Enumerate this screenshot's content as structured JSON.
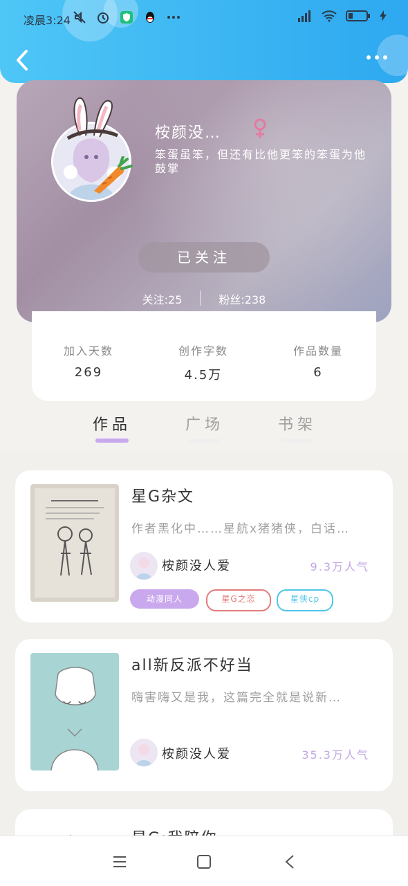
{
  "status_bar": {
    "time": "凌晨3:24",
    "icons": [
      "mute-icon",
      "alarm-icon",
      "security-app-icon",
      "qq-icon",
      "more-dots-icon"
    ],
    "right_icons": [
      "signal-icon",
      "wifi-icon",
      "battery-icon",
      "charging-icon"
    ]
  },
  "header": {
    "back_icon": "chevron-left-icon",
    "more_icon": "more-horizontal-icon"
  },
  "profile": {
    "username": "桉颜没…",
    "gender_icon": "female-icon",
    "bio": "笨蛋虽笨，但还有比他更笨的笨蛋为他鼓掌",
    "follow_button": "已关注",
    "following_text": "关注:25",
    "followers_text": "粉丝:238"
  },
  "stats": [
    {
      "label": "加入天数",
      "value": "269"
    },
    {
      "label": "创作字数",
      "value": "4.5万"
    },
    {
      "label": "作品数量",
      "value": "6"
    }
  ],
  "tabs": [
    {
      "label": "作品",
      "active": true
    },
    {
      "label": "广场",
      "active": false
    },
    {
      "label": "书架",
      "active": false
    }
  ],
  "works": [
    {
      "title": "星G杂文",
      "description": "作者黑化中……星航x猪猪侠，白话…",
      "author": "桉颜没人爱",
      "popularity": "9.3万人气",
      "tags": [
        "动漫同人",
        "星G之恋",
        "星侠cp"
      ]
    },
    {
      "title": "all新反派不好当",
      "description": "嗨害嗨又是我，这篇完全就是说新…",
      "author": "桉颜没人爱",
      "popularity": "35.3万人气",
      "tags": []
    },
    {
      "title": "星G:我陪你",
      "description": "",
      "author": "",
      "popularity": "",
      "tags": []
    }
  ],
  "colors": {
    "header_blue": "#2ea8f0",
    "accent_purple": "#c2a7e4",
    "tag_purple": "#c9a8ee",
    "tag_red": "#e27b7b",
    "tag_cyan": "#4ec6e8"
  },
  "bottom_nav": [
    "menu-icon",
    "home-square-icon",
    "back-triangle-icon"
  ]
}
